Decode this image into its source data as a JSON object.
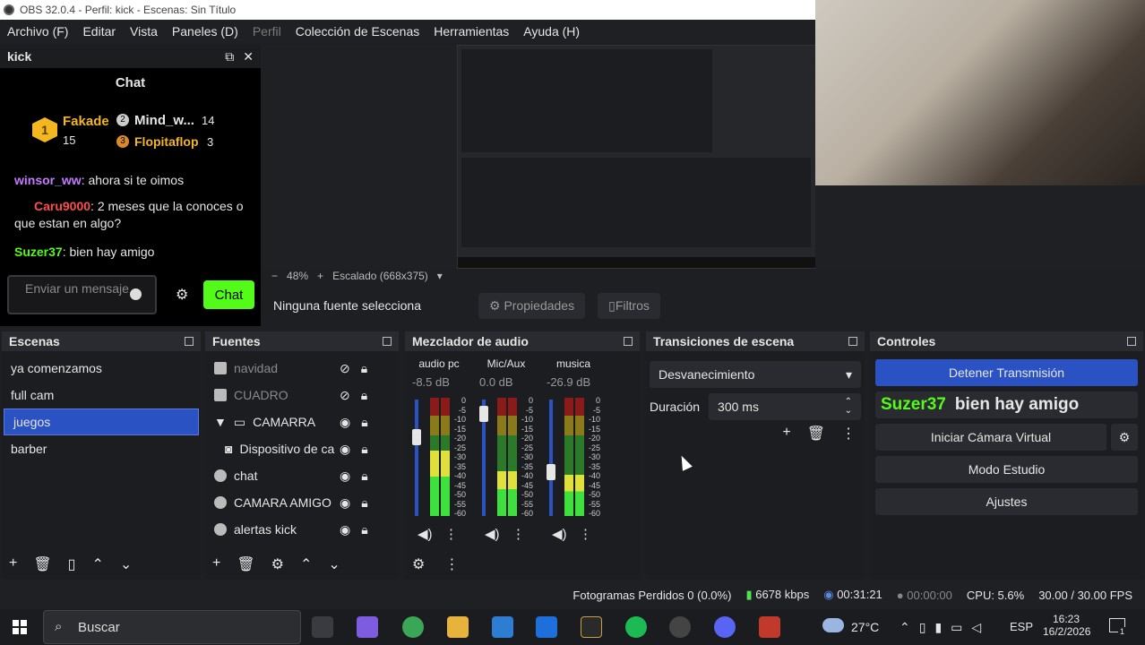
{
  "window": {
    "title": "OBS 32.0.4 - Perfil: kick - Escenas: Sin Título"
  },
  "menu": [
    "Archivo (F)",
    "Editar",
    "Vista",
    "Paneles (D)",
    "Perfil",
    "Colección de Escenas",
    "Herramientas",
    "Ayuda (H)"
  ],
  "kick": {
    "dock_title": "kick",
    "chat_title": "Chat",
    "top": [
      {
        "rank": "1",
        "name": "Fakade",
        "count": "15"
      },
      {
        "rank": "2",
        "name": "Mind_w...",
        "count": "14"
      },
      {
        "rank": "3",
        "name": "Flopitaflop",
        "count": "3"
      }
    ],
    "messages": [
      {
        "user": "winsor_ww",
        "text": "ahora si te oimos"
      },
      {
        "user": "Caru9000",
        "text": "2 meses que la conoces o que estan en algo?"
      },
      {
        "user": "Suzer37",
        "text": "bien hay amigo"
      }
    ],
    "input_placeholder": "Enviar un mensaje",
    "send_label": "Chat"
  },
  "preview": {
    "zoom": "48%",
    "scaling": "Escalado (668x375)",
    "no_source": "Ninguna fuente selecciona",
    "properties": "Propiedades",
    "filters": "Filtros"
  },
  "scenes": {
    "title": "Escenas",
    "items": [
      "ya comenzamos",
      "full cam",
      "juegos",
      "barber"
    ],
    "selected": "juegos"
  },
  "sources": {
    "title": "Fuentes",
    "items": [
      {
        "name": "navidad",
        "hidden": true
      },
      {
        "name": "CUADRO",
        "hidden": true
      },
      {
        "name": "CAMARRA",
        "hidden": false
      },
      {
        "name": "Dispositivo de ca",
        "hidden": false
      },
      {
        "name": "chat",
        "hidden": false
      },
      {
        "name": "CAMARA AMIGO",
        "hidden": false
      },
      {
        "name": "alertas kick",
        "hidden": false
      }
    ]
  },
  "mixer": {
    "title": "Mezclador de audio",
    "channels": [
      {
        "name": "audio pc",
        "db": "-8.5 dB",
        "level": 0.55
      },
      {
        "name": "Mic/Aux",
        "db": "0.0 dB",
        "level": 0.38
      },
      {
        "name": "musica",
        "db": "-26.9 dB",
        "level": 0.35
      }
    ],
    "scale": [
      "0",
      "-5",
      "-10",
      "-15",
      "-20",
      "-25",
      "-30",
      "-35",
      "-40",
      "-45",
      "-50",
      "-55",
      "-60"
    ]
  },
  "transitions": {
    "title": "Transiciones de escena",
    "selected": "Desvanecimiento",
    "duration_label": "Duración",
    "duration": "300 ms"
  },
  "controls": {
    "title": "Controles",
    "stop_stream": "Detener Transmisión",
    "overlay_user": "Suzer37",
    "overlay_text": "bien hay amigo",
    "virtual_cam": "Iniciar Cámara Virtual",
    "studio": "Modo Estudio",
    "settings": "Ajustes"
  },
  "status": {
    "dropped": "Fotogramas Perdidos 0 (0.0%)",
    "bitrate": "6678 kbps",
    "stream_time": "00:31:21",
    "rec_time": "00:00:00",
    "cpu": "CPU: 5.6%",
    "fps": "30.00 / 30.00 FPS"
  },
  "taskbar": {
    "search": "Buscar",
    "weather": "27°C",
    "lang": "ESP",
    "time": "16:23",
    "date": "16/2/2026",
    "notif": "1"
  },
  "colors": {
    "accent": "#2b52c2",
    "kick_green": "#53fc18",
    "gold": "#f3b720"
  }
}
